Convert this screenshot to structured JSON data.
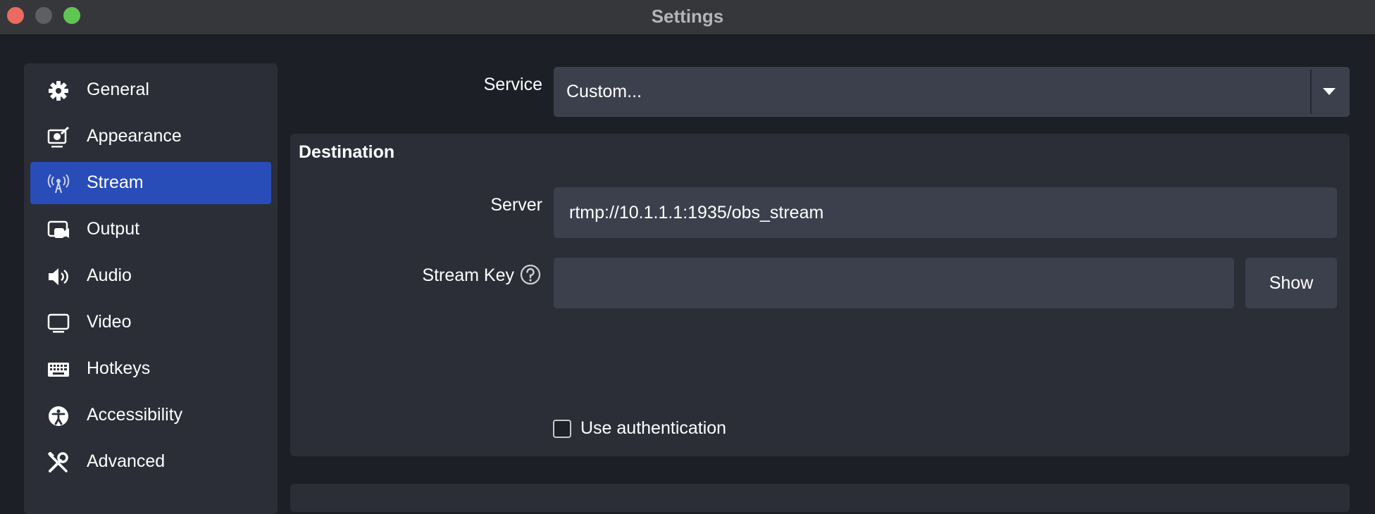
{
  "window": {
    "title": "Settings"
  },
  "sidebar": {
    "items": [
      {
        "label": "General",
        "icon": "gear-icon"
      },
      {
        "label": "Appearance",
        "icon": "appearance-icon"
      },
      {
        "label": "Stream",
        "icon": "antenna-icon",
        "active": true
      },
      {
        "label": "Output",
        "icon": "output-icon"
      },
      {
        "label": "Audio",
        "icon": "speaker-icon"
      },
      {
        "label": "Video",
        "icon": "monitor-icon"
      },
      {
        "label": "Hotkeys",
        "icon": "keyboard-icon"
      },
      {
        "label": "Accessibility",
        "icon": "accessibility-icon"
      },
      {
        "label": "Advanced",
        "icon": "tools-icon"
      }
    ]
  },
  "stream": {
    "service_label": "Service",
    "service_value": "Custom...",
    "destination_title": "Destination",
    "server_label": "Server",
    "server_value": "rtmp://10.1.1.1:1935/obs_stream",
    "stream_key_label": "Stream Key",
    "stream_key_value": "",
    "show_button": "Show",
    "use_auth_label": "Use authentication",
    "use_auth_checked": false
  },
  "colors": {
    "accent": "#284cb8",
    "background": "#1d1f26",
    "panel": "#2b2e37",
    "input": "#3c404d"
  }
}
